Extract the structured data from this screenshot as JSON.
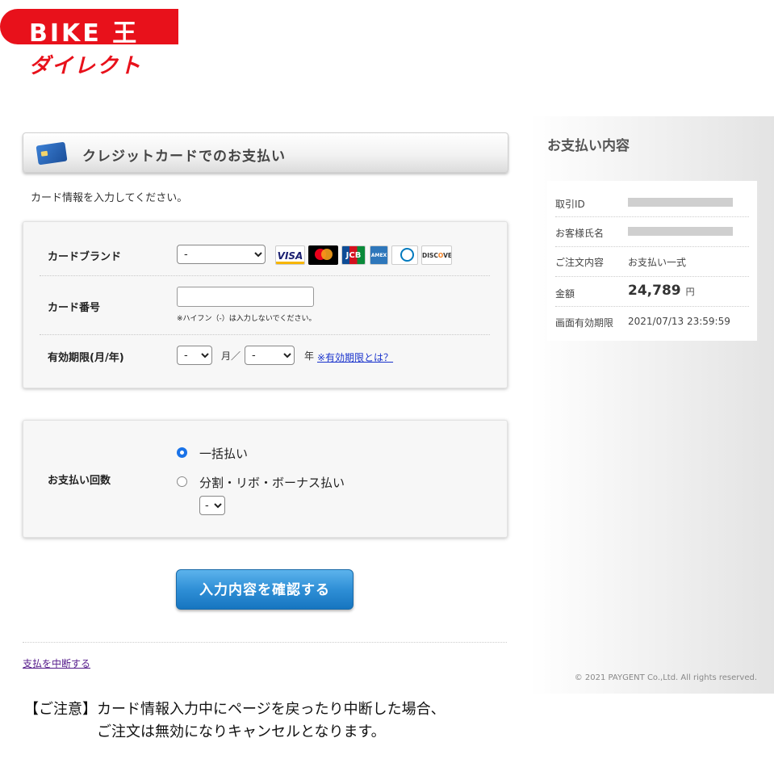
{
  "logo": {
    "brand": "BIKE 王",
    "sub": "ダイレクト"
  },
  "header": {
    "title": "クレジットカードでのお支払い",
    "icon": "credit-card-icon"
  },
  "instruction": "カード情報を入力してください。",
  "form": {
    "card_brand_label": "カードブランド",
    "card_brand_value": "-",
    "brands": [
      "VISA",
      "mastercard",
      "JCB",
      "AMERICAN EXPRESS",
      "Diners Club INTERNATIONAL",
      "DISCOVER"
    ],
    "card_number_label": "カード番号",
    "card_number_value": "",
    "card_number_hint": "※ハイフン（-）は入力しないでください。",
    "expiry_label": "有効期限(月/年)",
    "expiry_month_value": "-",
    "expiry_month_unit": "月／",
    "expiry_year_value": "-",
    "expiry_year_unit": "年",
    "expiry_help_link": "※有効期限とは？"
  },
  "payment_count": {
    "label": "お支払い回数",
    "option_lump": "一括払い",
    "option_split": "分割・リボ・ボーナス払い",
    "split_select_value": "-",
    "selected": "lump"
  },
  "confirm_button": "入力内容を確認する",
  "cancel_link": "支払を中断する",
  "notice": {
    "line1": "【ご注意】カード情報入力中にページを戻ったり中断した場合、",
    "line2": "ご注文は無効になりキャンセルとなります。"
  },
  "summary": {
    "title": "お支払い内容",
    "transaction_id_label": "取引ID",
    "customer_name_label": "お客様氏名",
    "order_label": "ご注文内容",
    "order_value": "お支払い一式",
    "amount_label": "金額",
    "amount_value": "24,789",
    "amount_unit": "円",
    "expiry_label": "画面有効期限",
    "expiry_value": "2021/07/13 23:59:59"
  },
  "copyright": "© 2021 PAYGENT Co.,Ltd. All rights reserved.",
  "colors": {
    "brand_red": "#e8111b",
    "button_blue": "#2f8fd6",
    "link_blue": "#1a33cc"
  }
}
